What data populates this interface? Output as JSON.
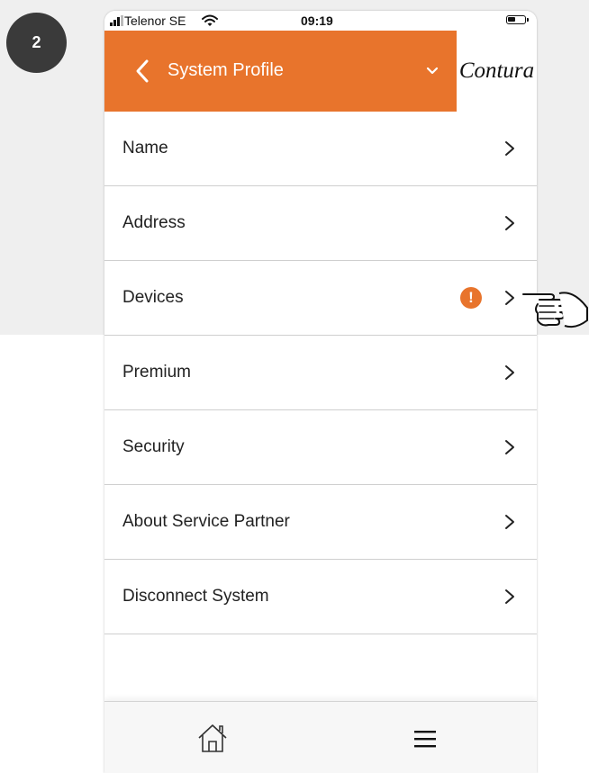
{
  "step": {
    "number": "2"
  },
  "status_bar": {
    "carrier": "Telenor SE",
    "time": "09:19"
  },
  "header": {
    "title": "System Profile",
    "logo": "Contura",
    "back_icon": "chevron-left-icon",
    "dropdown_icon": "chevron-down-icon"
  },
  "menu": {
    "items": [
      {
        "label": "Name"
      },
      {
        "label": "Address"
      },
      {
        "label": "Devices",
        "alert": "!"
      },
      {
        "label": "Premium"
      },
      {
        "label": "Security"
      },
      {
        "label": "About Service Partner"
      },
      {
        "label": "Disconnect System"
      }
    ]
  },
  "tab_bar": {
    "home_icon": "home-icon",
    "menu_icon": "hamburger-menu-icon"
  },
  "colors": {
    "accent": "#e8742c",
    "badge": "#3a3a3a",
    "background_gray": "#efefef"
  }
}
